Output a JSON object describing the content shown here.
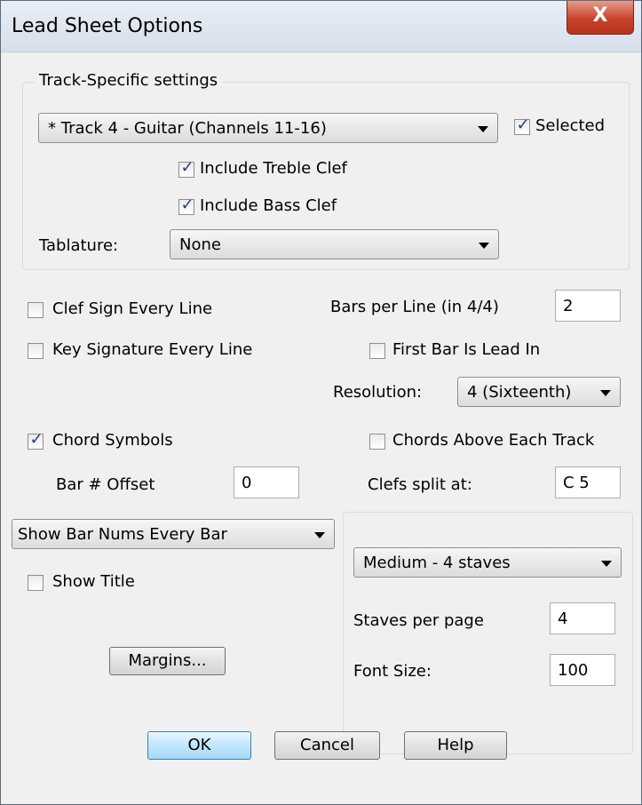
{
  "window": {
    "title": "Lead Sheet Options",
    "close_label": "X"
  },
  "track_group": {
    "title": "Track-Specific settings",
    "track_select": "* Track 4 - Guitar (Channels 11-16)",
    "selected": {
      "label": "Selected",
      "checked": true
    },
    "include_treble": {
      "label": "Include Treble Clef",
      "checked": true
    },
    "include_bass": {
      "label": "Include Bass Clef",
      "checked": true
    },
    "tablature_label": "Tablature:",
    "tablature_value": "None"
  },
  "options": {
    "clef_sign": {
      "label": "Clef Sign Every Line",
      "checked": false
    },
    "key_sig": {
      "label": "Key Signature Every Line",
      "checked": false
    },
    "bars_per_line_label": "Bars per Line (in 4/4)",
    "bars_per_line_value": "2",
    "first_bar": {
      "label": "First Bar Is Lead In",
      "checked": false
    },
    "resolution_label": "Resolution:",
    "resolution_value": "4 (Sixteenth)",
    "chord_symbols": {
      "label": "Chord Symbols",
      "checked": true
    },
    "chords_above": {
      "label": "Chords Above Each Track",
      "checked": false
    },
    "bar_offset_label": "Bar # Offset",
    "bar_offset_value": "0",
    "clefs_split_label": "Clefs split at:",
    "clefs_split_value": "C 5",
    "bar_nums_value": "Show Bar Nums Every Bar",
    "show_title": {
      "label": "Show Title",
      "checked": false
    },
    "margins_label": "Margins..."
  },
  "staves_group": {
    "staves_value": "Medium - 4 staves",
    "staves_per_page_label": "Staves per page",
    "staves_per_page_value": "4",
    "font_size_label": "Font Size:",
    "font_size_value": "100"
  },
  "buttons": {
    "ok": "OK",
    "cancel": "Cancel",
    "help": "Help"
  },
  "colors": {
    "accent_check": "#1f3f86",
    "close_button": "#c6422a",
    "default_button": "#bee6fd"
  }
}
